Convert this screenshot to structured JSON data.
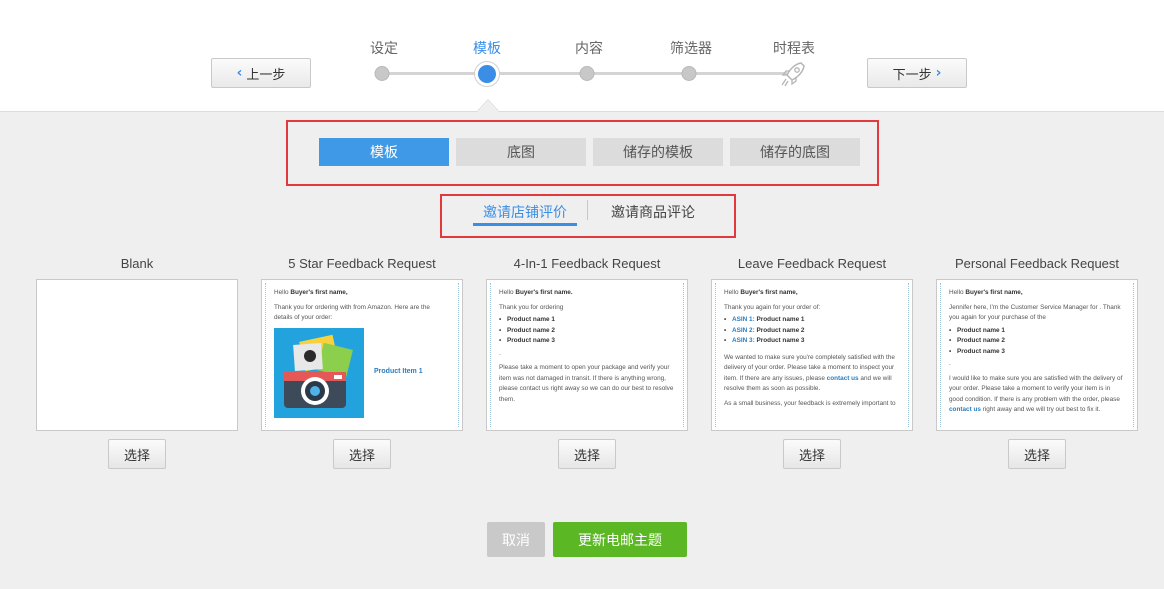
{
  "wizard": {
    "prev_label": "上一步",
    "next_label": "下一步",
    "steps": [
      {
        "label": "设定",
        "active": false
      },
      {
        "label": "模板",
        "active": true
      },
      {
        "label": "内容",
        "active": false
      },
      {
        "label": "筛选器",
        "active": false
      },
      {
        "label": "时程表",
        "active": false,
        "icon": "rocket-icon"
      }
    ]
  },
  "category_tabs": [
    {
      "label": "模板",
      "active": true
    },
    {
      "label": "底图",
      "active": false
    },
    {
      "label": "储存的模板",
      "active": false
    },
    {
      "label": "储存的底图",
      "active": false
    }
  ],
  "sub_tabs": [
    {
      "label": "邀请店铺评价",
      "active": true
    },
    {
      "label": "邀请商品评论",
      "active": false
    }
  ],
  "templates": [
    {
      "title": "Blank",
      "select_label": "选择"
    },
    {
      "title": "5 Star Feedback Request",
      "select_label": "选择",
      "preview": {
        "greeting_prefix": "Hello ",
        "greeting_name": "Buyer's first name,",
        "body": "Thank you for ordering with from Amazon. Here are the details of your order:",
        "product_link": "Product Item 1"
      }
    },
    {
      "title": "4-In-1 Feedback Request",
      "select_label": "选择",
      "preview": {
        "greeting_prefix": "Hello ",
        "greeting_name": "Buyer's first name.",
        "intro": "Thank you for ordering",
        "items": [
          "Product name 1",
          "Product name 2",
          "Product name 3"
        ],
        "dot": ".",
        "body": "Please take a moment to open your package and verify your item was not damaged in transit. If there is anything wrong, please contact us right away so we can do our best to resolve them."
      }
    },
    {
      "title": "Leave Feedback Request",
      "select_label": "选择",
      "preview": {
        "greeting_prefix": "Hello ",
        "greeting_name": "Buyer's first name,",
        "intro": "Thank you again for your order of:",
        "items": [
          {
            "asin": "ASIN 1:",
            "name": " Product name 1"
          },
          {
            "asin": "ASIN 2:",
            "name": " Product name 2"
          },
          {
            "asin": "ASIN 3:",
            "name": " Product name 3"
          }
        ],
        "body1": "We wanted to make sure you're completely satisfied with the delivery of your order. Please take a moment to inspect your item. If there are any issues, please ",
        "contact": "contact us",
        "body2": " and we will resolve them as soon as possible.",
        "body3": "As a small business, your feedback is extremely important to"
      }
    },
    {
      "title": "Personal Feedback Request",
      "select_label": "选择",
      "preview": {
        "greeting_prefix": "Hello ",
        "greeting_name": "Buyer's first name,",
        "intro": "Jennifer here, I'm the Customer Service Manager for . Thank you again for your purchase of the",
        "items": [
          "Product name 1",
          "Product name 2",
          "Product name 3"
        ],
        "dot": ".",
        "body1": "I would like to make sure you are satisfied with the delivery of your order. Please take a moment to verify your item is in good condition. If there is any problem with the order, please ",
        "contact": "contact us",
        "body2": " right away and we will try out best to fix it."
      }
    }
  ],
  "footer": {
    "cancel_label": "取消",
    "update_label": "更新电邮主题"
  },
  "colors": {
    "accent": "#3a8ee6",
    "success": "#5bb824",
    "highlight_box": "#e0393e"
  }
}
